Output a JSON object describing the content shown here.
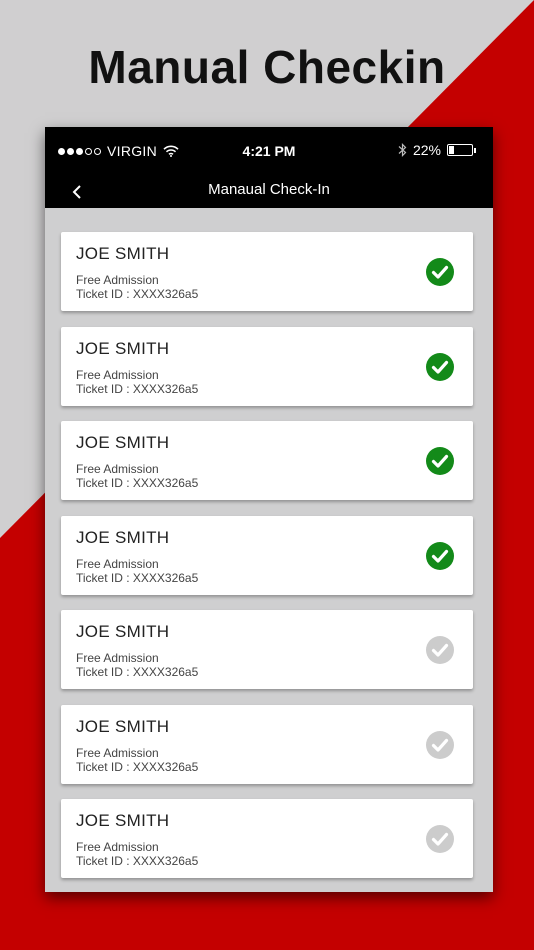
{
  "promo": {
    "title": "Manual Checkin"
  },
  "colors": {
    "accent": "#c40000",
    "checked": "#138a19",
    "unchecked": "#cccccc"
  },
  "status_bar": {
    "carrier": "VIRGIN",
    "time": "4:21 PM",
    "battery": "22%",
    "battery_level": 0.22
  },
  "nav": {
    "title": "Manaual Check-In",
    "back_icon": "chevron-left-icon"
  },
  "attendees": [
    {
      "name": "JOE SMITH",
      "type": "Free Admission",
      "ticket": "Ticket ID : XXXX326a5",
      "checked_in": true
    },
    {
      "name": "JOE SMITH",
      "type": "Free Admission",
      "ticket": "Ticket ID : XXXX326a5",
      "checked_in": true
    },
    {
      "name": "JOE SMITH",
      "type": "Free Admission",
      "ticket": "Ticket ID : XXXX326a5",
      "checked_in": true
    },
    {
      "name": "JOE SMITH",
      "type": "Free Admission",
      "ticket": "Ticket ID : XXXX326a5",
      "checked_in": true
    },
    {
      "name": "JOE SMITH",
      "type": "Free Admission",
      "ticket": "Ticket ID : XXXX326a5",
      "checked_in": false
    },
    {
      "name": "JOE SMITH",
      "type": "Free Admission",
      "ticket": "Ticket ID : XXXX326a5",
      "checked_in": false
    },
    {
      "name": "JOE SMITH",
      "type": "Free Admission",
      "ticket": "Ticket ID : XXXX326a5",
      "checked_in": false
    }
  ]
}
